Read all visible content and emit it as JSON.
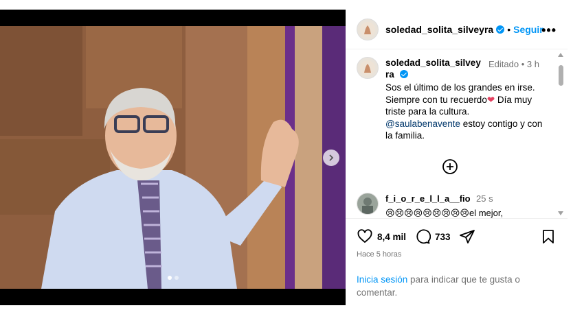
{
  "header": {
    "username": "soledad_solita_silveyra",
    "separator": "•",
    "follow_label": "Seguir",
    "more_label": "•••"
  },
  "caption": {
    "username": "soledad_solita_silveyra",
    "edited": "Editado",
    "time_sep": "•",
    "time": "3 h",
    "text_1": "Sos el último de los grandes en irse. Siempre con tu recuerdo",
    "heart": "❤",
    "text_2": " Día muy triste para la cultura.",
    "mention": "@saulabenavente",
    "text_3": " estoy contigo y con la familia."
  },
  "reply": {
    "username": "f_i_o_r_e_l_l_a__fio",
    "time": "25 s",
    "text": "😢😢😢😢😢😢😢😢😢el mejor,"
  },
  "actions": {
    "likes": "8,4 mil",
    "comments": "733",
    "time_ago": "Hace 5 horas"
  },
  "login": {
    "link": "Inicia sesión",
    "text": " para indicar que te gusta o comentar."
  },
  "colors": {
    "accent": "#0095f6",
    "verified": "#0095f6",
    "heart": "#e4405f",
    "muted": "#737373"
  },
  "media": {
    "carousel_total": 2,
    "carousel_current": 1
  }
}
